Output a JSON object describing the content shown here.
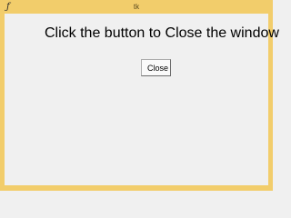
{
  "window": {
    "title": "tk",
    "icon": "feather-icon",
    "accent_color": "#f2cd6b"
  },
  "main": {
    "heading": "Click the button to Close the window",
    "close_button_label": "Close"
  }
}
